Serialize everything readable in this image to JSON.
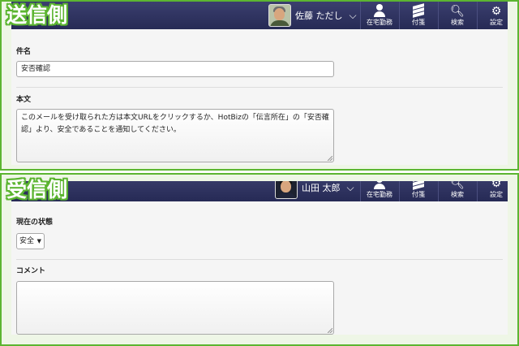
{
  "sender_panel": {
    "badge": "送信側",
    "user_name": "佐藤 ただし",
    "nav": [
      {
        "label": "在宅勤務",
        "icon": "person-icon"
      },
      {
        "label": "付箋",
        "icon": "sticky-note-icon"
      },
      {
        "label": "検索",
        "icon": "search-icon"
      },
      {
        "label": "設定",
        "icon": "gear-icon"
      }
    ],
    "subject_label": "件名",
    "subject_value": "安否確認",
    "body_label": "本文",
    "body_text": "このメールを受け取られた方は本文URLをクリックするか、HotBizの「伝言所在」の「安否確認」より、安全であることを通知してください。"
  },
  "receiver_panel": {
    "badge": "受信側",
    "user_name": "山田 太郎",
    "nav": [
      {
        "label": "在宅勤務",
        "icon": "person-icon"
      },
      {
        "label": "付箋",
        "icon": "sticky-note-icon"
      },
      {
        "label": "検索",
        "icon": "search-icon"
      },
      {
        "label": "設定",
        "icon": "gear-icon"
      }
    ],
    "status_label": "現在の状態",
    "status_value": "安全",
    "comment_label": "コメント",
    "comment_value": ""
  },
  "colors": {
    "frame_border": "#5cb531",
    "topbar": "#2f3361",
    "panel_bg": "#f5f5f5"
  }
}
